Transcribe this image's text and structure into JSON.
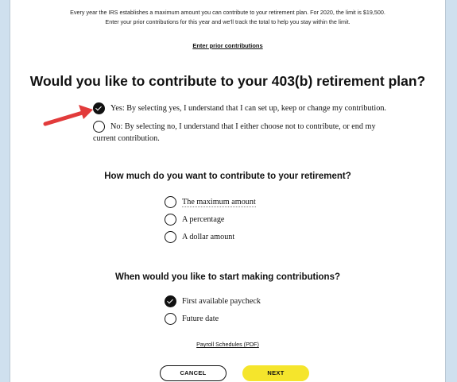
{
  "intro": {
    "line1": "Every year the IRS establishes a maximum amount you can contribute to your retirement plan. For 2020, the limit is $19,500.",
    "line2": "Enter your prior contributions for this year and we'll track the total to help you stay within the limit."
  },
  "enter_prior_link": "Enter prior contributions",
  "question_main": "Would you like to contribute to your 403(b) retirement plan?",
  "contribute_options": [
    {
      "label": "Yes: By selecting yes, I understand that I can set up, keep or change my contribution.",
      "checked": true
    },
    {
      "label_line1": "No: By selecting no, I understand that I either choose not to contribute, or end my",
      "label_line2": "current contribution.",
      "checked": false
    }
  ],
  "question_amount": "How much do you want to contribute to your retirement?",
  "amount_options": [
    {
      "label": "The maximum amount",
      "checked": false
    },
    {
      "label": "A percentage",
      "checked": false
    },
    {
      "label": "A dollar amount",
      "checked": false
    }
  ],
  "question_start": "When would you like to start making contributions?",
  "start_options": [
    {
      "label": "First available paycheck",
      "checked": true
    },
    {
      "label": "Future date",
      "checked": false
    }
  ],
  "payroll_link": "Payroll Schedules (PDF)",
  "buttons": {
    "cancel": "CANCEL",
    "next": "NEXT"
  },
  "colors": {
    "accent_arrow": "#e23b3b",
    "next_button": "#f5e52c",
    "page_bg": "#cfe0ee"
  }
}
